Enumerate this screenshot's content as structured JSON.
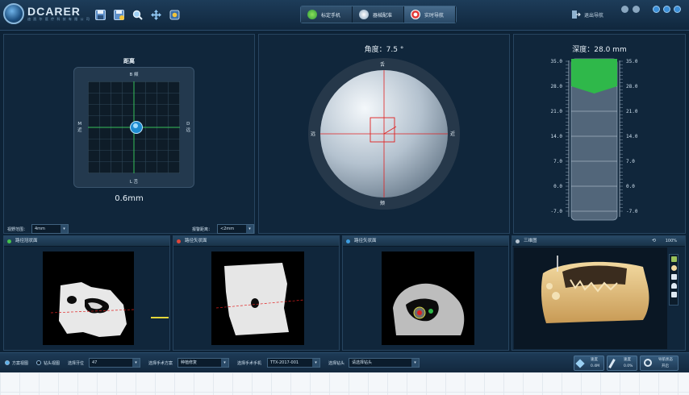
{
  "header": {
    "brand_name": "DCARER",
    "brand_sub": "迪 凯 尔 医 疗 科 技 有 限 公 司",
    "toolbar_icons": [
      "save-icon",
      "save-as-icon",
      "zoom-icon",
      "move-icon",
      "settings-icon"
    ],
    "nav_tabs": [
      {
        "label": "标定手机",
        "icon": "calibrate-icon",
        "active": false
      },
      {
        "label": "器械配准",
        "icon": "register-icon",
        "active": false
      },
      {
        "label": "实时导航",
        "icon": "target-icon",
        "active": true
      }
    ],
    "exit_label": "退出导航"
  },
  "distance_panel": {
    "title": "距离",
    "top_label": "B 颊",
    "bottom_label": "L 舌",
    "left_label_1": "M",
    "left_label_2": "近",
    "right_label_1": "D",
    "right_label_2": "远",
    "value": "0.6mm",
    "range_label": "视野范围：",
    "range_value": "4mm",
    "alert_label": "报警距离：",
    "alert_value": "<2mm"
  },
  "angle_panel": {
    "title": "角度：7.5 °",
    "top_label": "舌",
    "bottom_label": "颊",
    "left_label": "远",
    "right_label": "近"
  },
  "depth_panel": {
    "title": "深度：28.0 mm",
    "ticks": [
      "35.0",
      "28.0",
      "21.0",
      "14.0",
      "7.0",
      "0.0",
      "-7.0"
    ],
    "depth_value": 28.0,
    "scale_min": -7.0,
    "scale_max": 35.0
  },
  "views": [
    {
      "title": "路径冠状面",
      "dot": "#45c24c"
    },
    {
      "title": "路径矢状面",
      "dot": "#e0473a"
    },
    {
      "title": "路径矢状面",
      "dot": "#3e9de0"
    },
    {
      "title": "三维图",
      "dot": "#b8c6d2"
    }
  ],
  "view3d_zoom": "100%",
  "footer": {
    "radio1": "方案视图",
    "radio2": "钻头视图",
    "select_tooth_label": "选择牙位",
    "select_tooth_value": "47",
    "select_plan_label": "选择手术方案",
    "select_plan_value": "种植修复",
    "select_handpiece_label": "选择手术手机",
    "select_handpiece_value": "TTX-2017-001",
    "select_drill_label": "选择钻头",
    "select_drill_value": "请选择钻头",
    "btn1_label": "速度",
    "btn1_value": "0.4M",
    "btn2_label": "速度",
    "btn2_value": "0.0%",
    "btn3_label_1": "导航状态",
    "btn3_label_2": "开启"
  },
  "colors": {
    "accent_green": "#2fb84a",
    "crosshair_red": "#e02020",
    "crosshair_green": "#37c15a"
  }
}
